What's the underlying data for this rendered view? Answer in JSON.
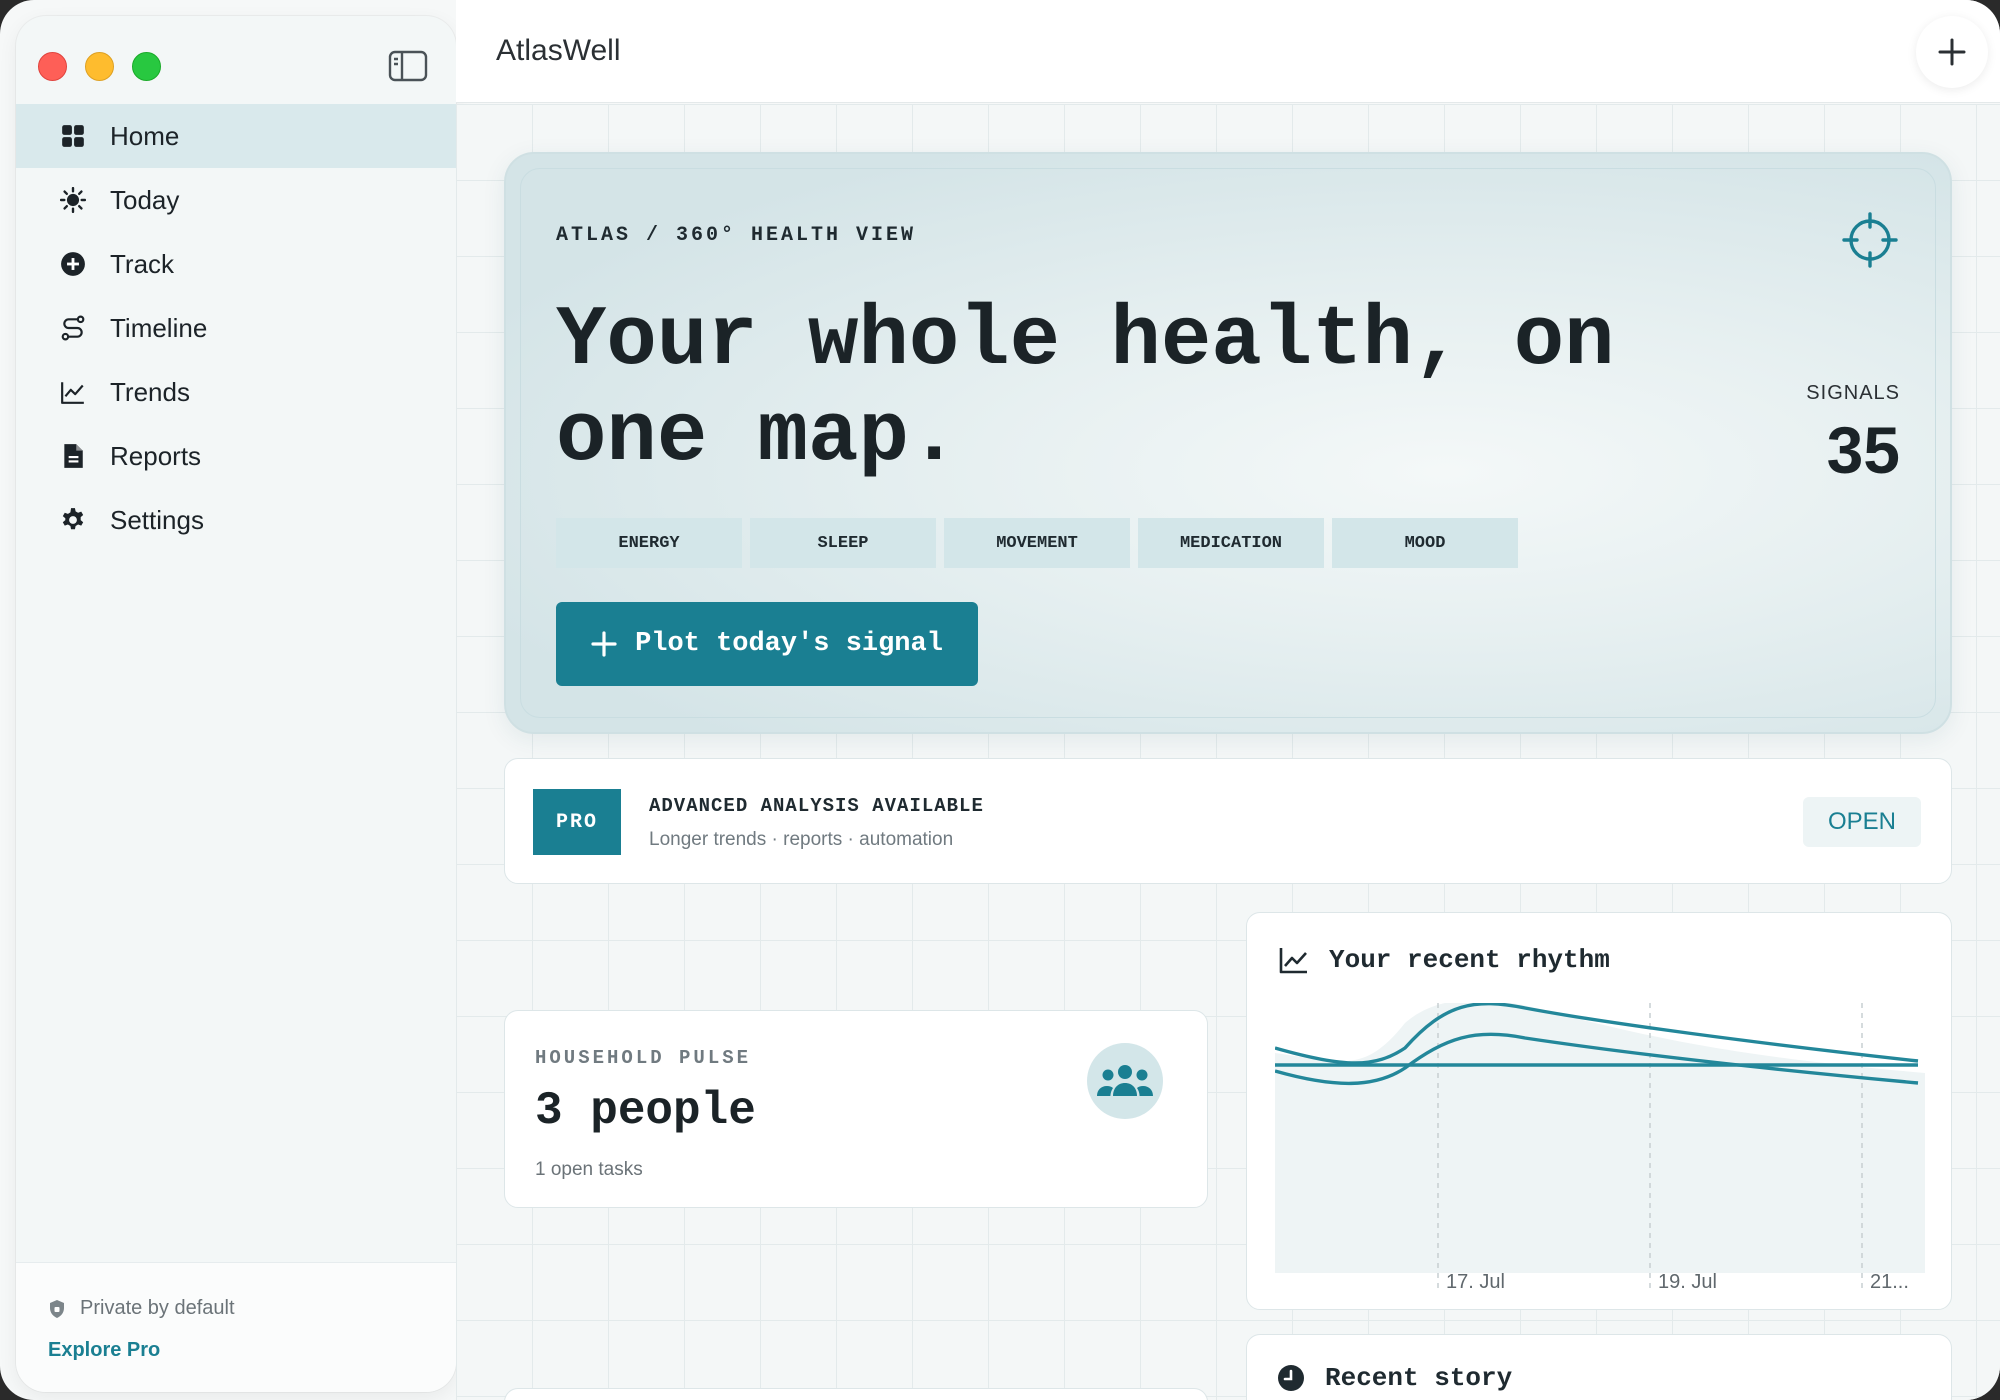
{
  "app": {
    "title": "AtlasWell"
  },
  "sidebar": {
    "items": [
      {
        "label": "Home",
        "icon": "grid-icon",
        "active": true
      },
      {
        "label": "Today",
        "icon": "sun-icon"
      },
      {
        "label": "Track",
        "icon": "plus-circle-icon"
      },
      {
        "label": "Timeline",
        "icon": "route-icon"
      },
      {
        "label": "Trends",
        "icon": "line-chart-icon"
      },
      {
        "label": "Reports",
        "icon": "document-icon"
      },
      {
        "label": "Settings",
        "icon": "gear-icon"
      }
    ],
    "footer": {
      "privacy": "Private by default",
      "explore": "Explore Pro"
    }
  },
  "hero": {
    "eyebrow": "ATLAS / 360° HEALTH VIEW",
    "title": "Your whole health, on one map.",
    "signals_label": "SIGNALS",
    "signals_value": "35",
    "chips": [
      "ENERGY",
      "SLEEP",
      "MOVEMENT",
      "MEDICATION",
      "MOOD"
    ],
    "cta": "Plot today's signal"
  },
  "pro": {
    "badge": "PRO",
    "title": "ADVANCED ANALYSIS AVAILABLE",
    "subtitle": "Longer trends · reports · automation",
    "action": "OPEN"
  },
  "household": {
    "label": "HOUSEHOLD PULSE",
    "value": "3 people",
    "sub": "1 open tasks"
  },
  "rhythm": {
    "title": "Your recent rhythm",
    "ticks": [
      "17. Jul",
      "19. Jul",
      "21..."
    ]
  },
  "story": {
    "title": "Recent story"
  },
  "colors": {
    "accent": "#1a7f92",
    "chip": "#d3e6e9",
    "active_nav": "#d9e9ec"
  }
}
